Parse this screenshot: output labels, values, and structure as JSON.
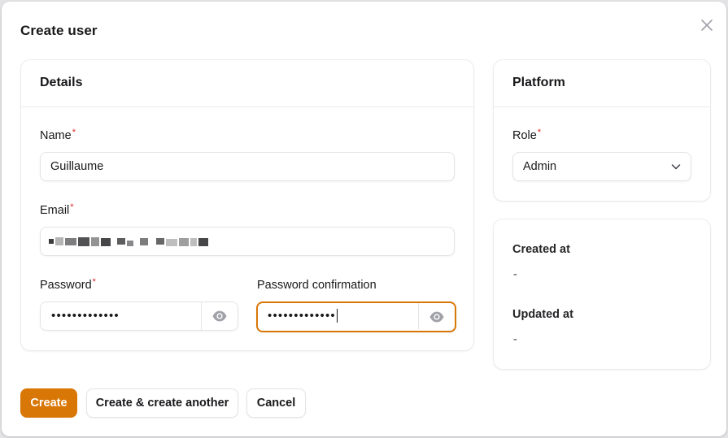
{
  "modal": {
    "title": "Create user"
  },
  "details": {
    "title": "Details",
    "name": {
      "label": "Name",
      "required_mark": "*",
      "value": "Guillaume"
    },
    "email": {
      "label": "Email",
      "required_mark": "*"
    },
    "password": {
      "label": "Password",
      "required_mark": "*",
      "masked": "•••••••••••••"
    },
    "password_confirmation": {
      "label": "Password confirmation",
      "masked": "•••••••••••••"
    }
  },
  "platform": {
    "title": "Platform",
    "role": {
      "label": "Role",
      "required_mark": "*",
      "value": "Admin"
    }
  },
  "meta": {
    "created_at_label": "Created at",
    "created_at_value": "-",
    "updated_at_label": "Updated at",
    "updated_at_value": "-"
  },
  "actions": {
    "create": "Create",
    "create_another": "Create & create another",
    "cancel": "Cancel"
  },
  "colors": {
    "primary": "#d97706",
    "required": "#dc2626",
    "border": "#e4e4e7"
  },
  "icons": {
    "close": "close-icon",
    "eye": "eye-icon",
    "chevron": "chevron-down-icon"
  }
}
